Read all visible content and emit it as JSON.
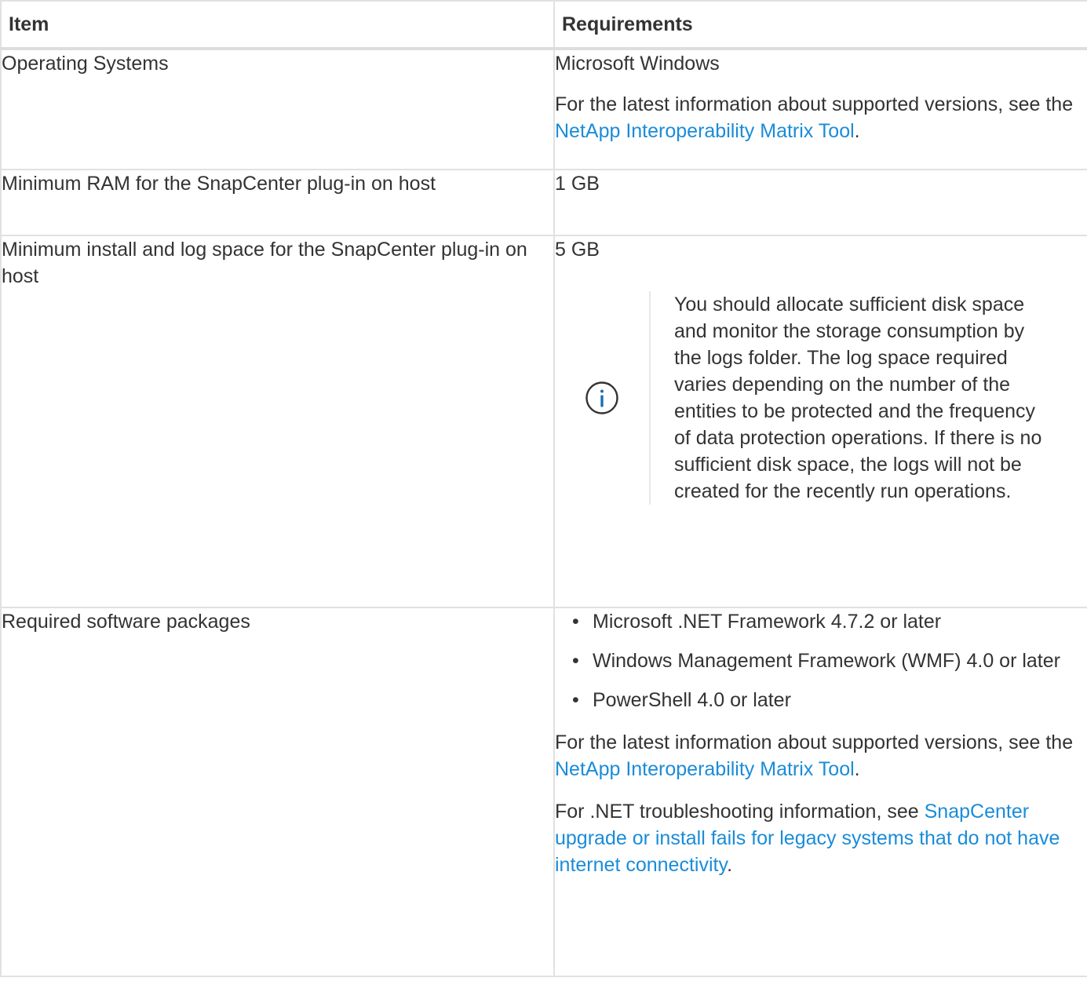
{
  "table": {
    "headers": {
      "item": "Item",
      "requirements": "Requirements"
    },
    "rows": [
      {
        "item": "Operating Systems",
        "req_line": "Microsoft Windows",
        "info_prefix": "For the latest information about supported versions, see the",
        "info_link": "NetApp Interoperability Matrix Tool",
        "info_suffix": "."
      },
      {
        "item": "Minimum RAM for the SnapCenter plug-in on host",
        "req_line": "1 GB"
      },
      {
        "item": "Minimum install and log space for the SnapCenter plug-in on host",
        "req_line": "5 GB",
        "note_icon": "info-circle-icon",
        "note_text": "You should allocate sufficient disk space and monitor the storage consumption by the logs folder. The log space required varies depending on the number of the entities to be protected and the frequency of data protection operations. If there is no sufficient disk space, the logs will not be created for the recently run operations."
      },
      {
        "item": "Required software packages",
        "packages": [
          "Microsoft .NET Framework 4.7.2 or later",
          "Windows Management Framework (WMF) 4.0 or later",
          "PowerShell 4.0 or later"
        ],
        "info_prefix": "For the latest information about supported versions, see the",
        "info_link": "NetApp Interoperability Matrix Tool",
        "info_suffix": ".",
        "troubleshoot_prefix": "For .NET troubleshooting information, see",
        "troubleshoot_link": "SnapCenter upgrade or install fails for legacy systems that do not have internet connectivity",
        "troubleshoot_suffix": "."
      }
    ]
  },
  "colors": {
    "link": "#1a8cd8",
    "text": "#333333",
    "border": "#e1e1e1",
    "icon": "#1a6fb5"
  }
}
